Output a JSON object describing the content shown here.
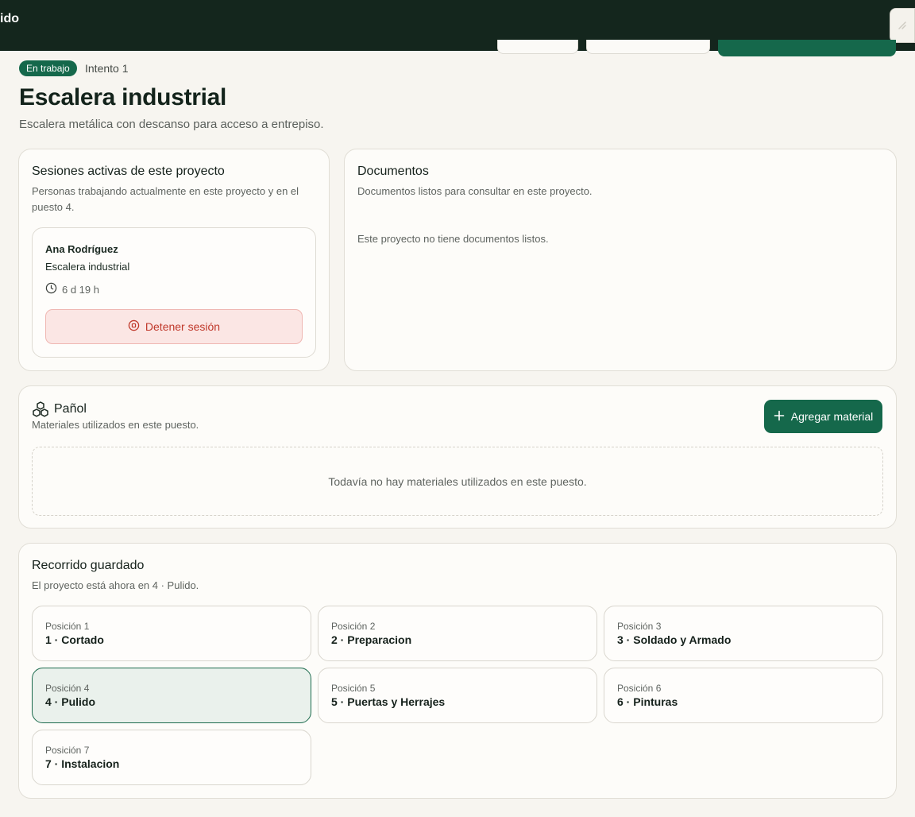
{
  "topbar": {
    "title": "ido",
    "close_icon": "close-icon"
  },
  "header": {
    "badge": "En trabajo",
    "attempt": "Intento 1",
    "title": "Escalera industrial",
    "subtitle": "Escalera metálica con descanso para acceso a entrepiso."
  },
  "sessions": {
    "title": "Sesiones activas de este proyecto",
    "subtitle": "Personas trabajando actualmente en este proyecto y en el puesto 4.",
    "items": [
      {
        "name": "Ana Rodríguez",
        "project": "Escalera industrial",
        "elapsed": "6 d 19 h",
        "stop_label": "Detener sesión"
      }
    ]
  },
  "documents": {
    "title": "Documentos",
    "subtitle": "Documentos listos para consultar en este proyecto.",
    "empty": "Este proyecto no tiene documentos listos."
  },
  "panol": {
    "title": "Pañol",
    "subtitle": "Materiales utilizados en este puesto.",
    "add_label": "Agregar material",
    "empty": "Todavía no hay materiales utilizados en este puesto."
  },
  "route": {
    "title": "Recorrido guardado",
    "subtitle": "El proyecto está ahora en 4 · Pulido.",
    "stages": [
      {
        "position": "Posición 1",
        "label": "1 · Cortado",
        "active": false
      },
      {
        "position": "Posición 2",
        "label": "2 · Preparacion",
        "active": false
      },
      {
        "position": "Posición 3",
        "label": "3 · Soldado y Armado",
        "active": false
      },
      {
        "position": "Posición 4",
        "label": "4 · Pulido",
        "active": true
      },
      {
        "position": "Posición 5",
        "label": "5 · Puertas y Herrajes",
        "active": false
      },
      {
        "position": "Posición 6",
        "label": "6 · Pinturas",
        "active": false
      },
      {
        "position": "Posición 7",
        "label": "7 · Instalacion",
        "active": false
      }
    ]
  },
  "colors": {
    "topbar": "#14261d",
    "accent": "#15684b",
    "danger": "#c0392b",
    "background": "#f7f5f0"
  }
}
